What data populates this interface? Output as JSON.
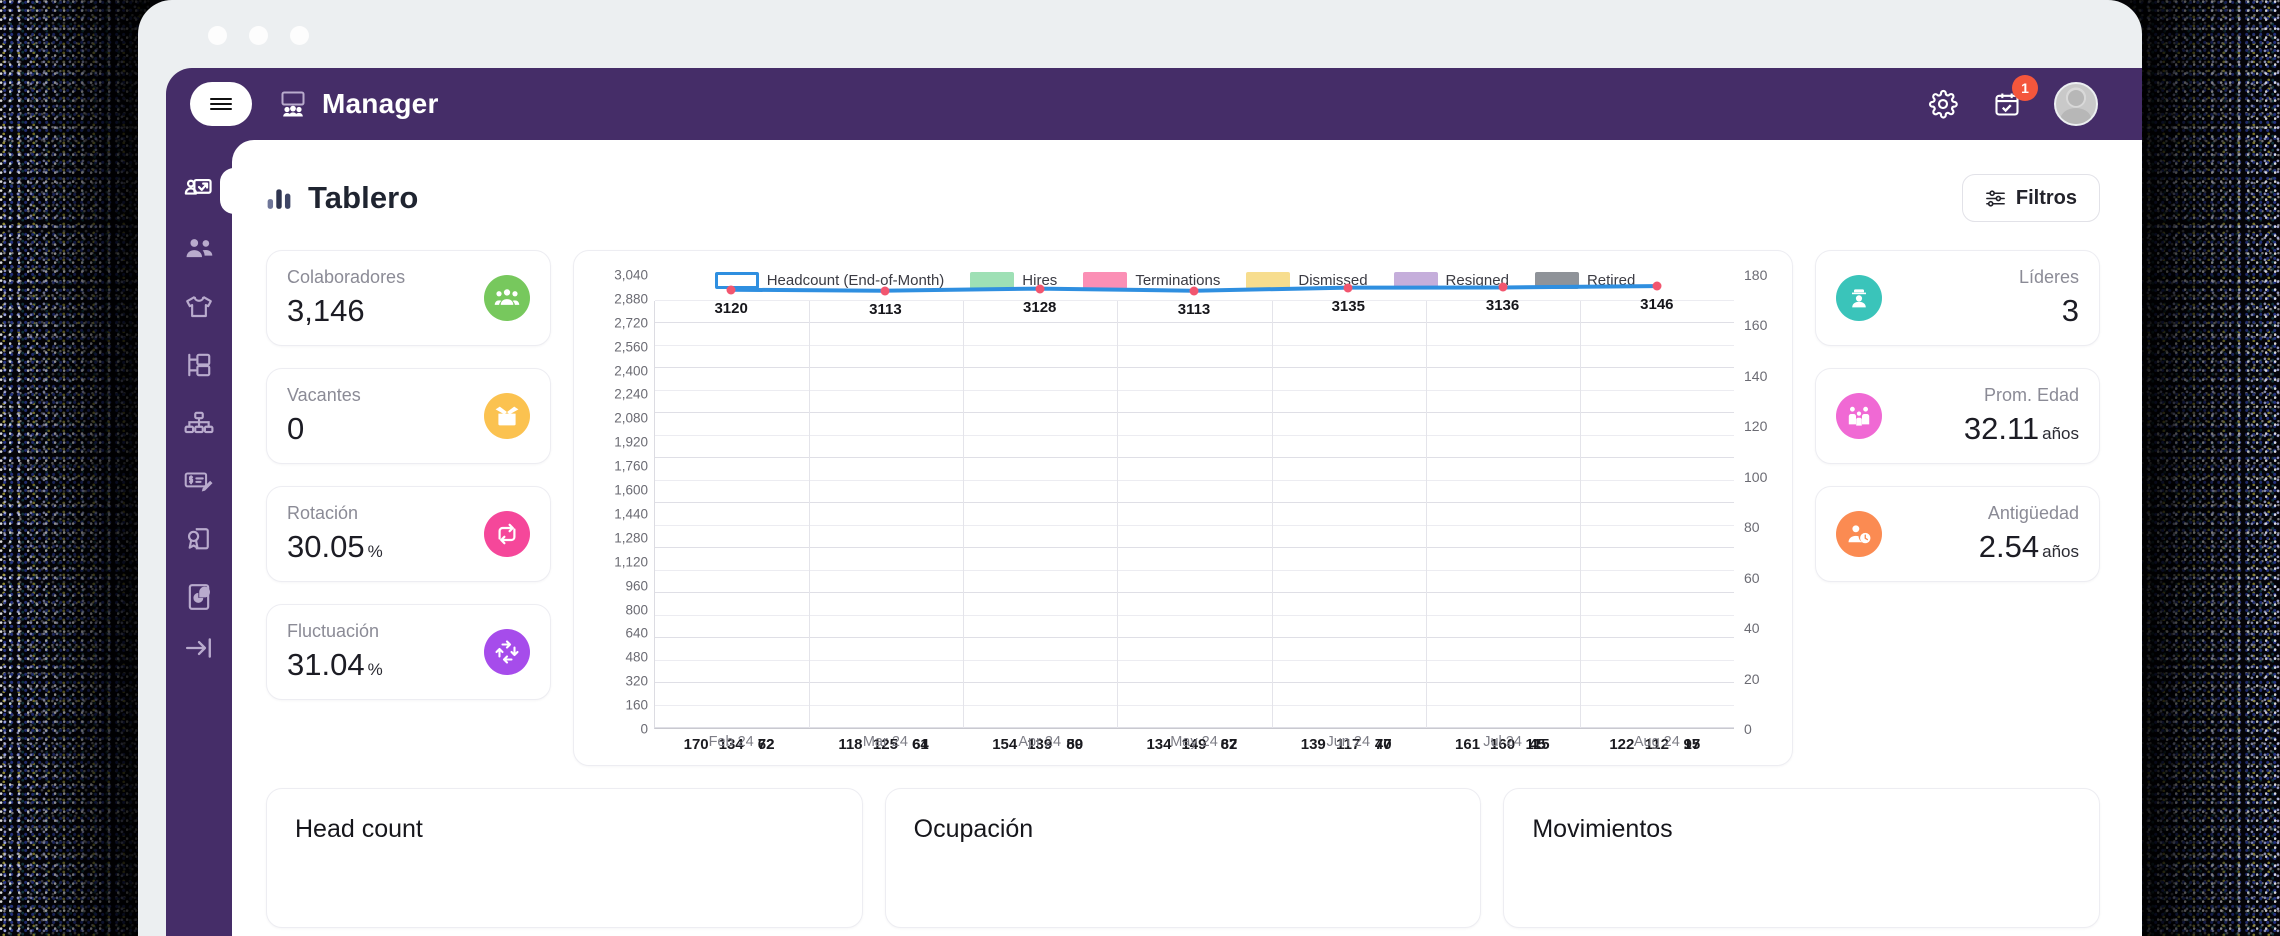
{
  "window": {
    "dots": [
      "close",
      "minimize",
      "maximize"
    ]
  },
  "topbar": {
    "menu_icon": "hamburger-icon",
    "brand_icon": "people-presentation-icon",
    "brand_title": "Manager",
    "settings_icon": "gear-icon",
    "calendar_icon": "calendar-check-icon",
    "notification_count": "1",
    "avatar_icon": "user-avatar",
    "background_color": "#452d68"
  },
  "sidebar": {
    "items": [
      {
        "icon": "dashboard-presentation-icon",
        "name": "tablero",
        "active": true
      },
      {
        "icon": "people-group-icon",
        "name": "colaboradores",
        "active": false
      },
      {
        "icon": "tshirt-icon",
        "name": "uniformes",
        "active": false
      },
      {
        "icon": "org-tree-icon",
        "name": "estructura",
        "active": false
      },
      {
        "icon": "hierarchy-icon",
        "name": "organigrama",
        "active": false
      },
      {
        "icon": "payroll-edit-icon",
        "name": "nomina",
        "active": false
      },
      {
        "icon": "certificate-document-icon",
        "name": "documentos",
        "active": false
      },
      {
        "icon": "report-pie-document-icon",
        "name": "reportes",
        "active": false
      }
    ],
    "collapse": {
      "icon": "arrow-right-bar-icon",
      "name": "collapse"
    }
  },
  "page": {
    "title_icon": "bar-chart-icon",
    "title": "Tablero",
    "filters_button": {
      "icon": "sliders-icon",
      "label": "Filtros"
    }
  },
  "kpis_left": [
    {
      "label": "Colaboradores",
      "value": "3,146",
      "unit": "",
      "icon": "people-group-icon",
      "color": "#77c85d"
    },
    {
      "label": "Vacantes",
      "value": "0",
      "unit": "",
      "icon": "open-box-icon",
      "color": "#fbc250"
    },
    {
      "label": "Rotación",
      "value": "30.05",
      "unit": "%",
      "icon": "rotate-arrows-icon",
      "color": "#f5479a"
    },
    {
      "label": "Fluctuación",
      "value": "31.04",
      "unit": "%",
      "icon": "refresh-cycle-icon",
      "color": "#a64ceb"
    }
  ],
  "kpis_right": [
    {
      "label": "Líderes",
      "value": "3",
      "unit": "",
      "icon": "leader-captain-icon",
      "color": "#3ac4ba"
    },
    {
      "label": "Prom. Edad",
      "value": "32.11",
      "unit": "años",
      "icon": "family-group-icon",
      "color": "#f069d4"
    },
    {
      "label": "Antigüedad",
      "value": "2.54",
      "unit": "años",
      "icon": "user-clock-icon",
      "color": "#fb8b52"
    }
  ],
  "panels": [
    {
      "title": "Head count"
    },
    {
      "title": "Ocupación"
    },
    {
      "title": "Movimientos"
    }
  ],
  "chart_data": {
    "type": "bar",
    "title": "",
    "xlabel": "",
    "ylabel": "",
    "grid": true,
    "legend_position": "top-center",
    "categories": [
      "Feb 24",
      "Mar 24",
      "Apr 24",
      "May 24",
      "Jun 24",
      "Jul 24",
      "Aug 24"
    ],
    "y_left": {
      "label": "",
      "min": 0,
      "max": 3040,
      "step": 160,
      "ticks": [
        "0",
        "160",
        "320",
        "480",
        "640",
        "800",
        "960",
        "1,120",
        "1,280",
        "1,440",
        "1,600",
        "1,760",
        "1,920",
        "2,080",
        "2,240",
        "2,400",
        "2,560",
        "2,720",
        "2,880",
        "3,040"
      ]
    },
    "y_right": {
      "label": "",
      "min": 0,
      "max": 180,
      "step": 20,
      "ticks": [
        "0",
        "20",
        "40",
        "60",
        "80",
        "100",
        "120",
        "140",
        "160",
        "180"
      ]
    },
    "series": [
      {
        "name": "Headcount (End-of-Month)",
        "type": "line",
        "axis": "left",
        "color": "#2f8fe0",
        "marker_color": "#f2566f",
        "values": [
          3120,
          3113,
          3128,
          3113,
          3135,
          3136,
          3146
        ],
        "labels": [
          "3120",
          "3113",
          "3128",
          "3113",
          "3135",
          "3136",
          "3146"
        ]
      },
      {
        "name": "Hires",
        "type": "bar",
        "axis": "right",
        "color": "#9ee0b5",
        "values": [
          170,
          118,
          154,
          134,
          139,
          161,
          122
        ]
      },
      {
        "name": "Terminations",
        "type": "bar",
        "axis": "right",
        "color": "#fb8fb5",
        "values": [
          134,
          125,
          139,
          149,
          117,
          160,
          112
        ]
      },
      {
        "name": "Dismissed",
        "type": "bar",
        "axis": "right",
        "color": "#f7dd8e",
        "stack": "reasons",
        "values": [
          72,
          64,
          89,
          87,
          47,
          45,
          17
        ]
      },
      {
        "name": "Resigned",
        "type": "bar",
        "axis": "right",
        "color": "#c5aedb",
        "stack": "reasons",
        "values": [
          62,
          61,
          50,
          62,
          70,
          115,
          95
        ]
      },
      {
        "name": "Retired",
        "type": "bar",
        "axis": "right",
        "color": "#8f9399",
        "stack": "reasons",
        "values": [
          0,
          0,
          0,
          0,
          0,
          0,
          0
        ]
      }
    ],
    "legend": [
      {
        "label": "Headcount (End-of-Month)",
        "color": "#2f8fe0",
        "style": "line"
      },
      {
        "label": "Hires",
        "color": "#9ee0b5",
        "style": "swatch"
      },
      {
        "label": "Terminations",
        "color": "#fb8fb5",
        "style": "swatch"
      },
      {
        "label": "Dismissed",
        "color": "#f7dd8e",
        "style": "swatch"
      },
      {
        "label": "Resigned",
        "color": "#c5aedb",
        "style": "swatch"
      },
      {
        "label": "Retired",
        "color": "#8f9399",
        "style": "swatch"
      }
    ]
  }
}
